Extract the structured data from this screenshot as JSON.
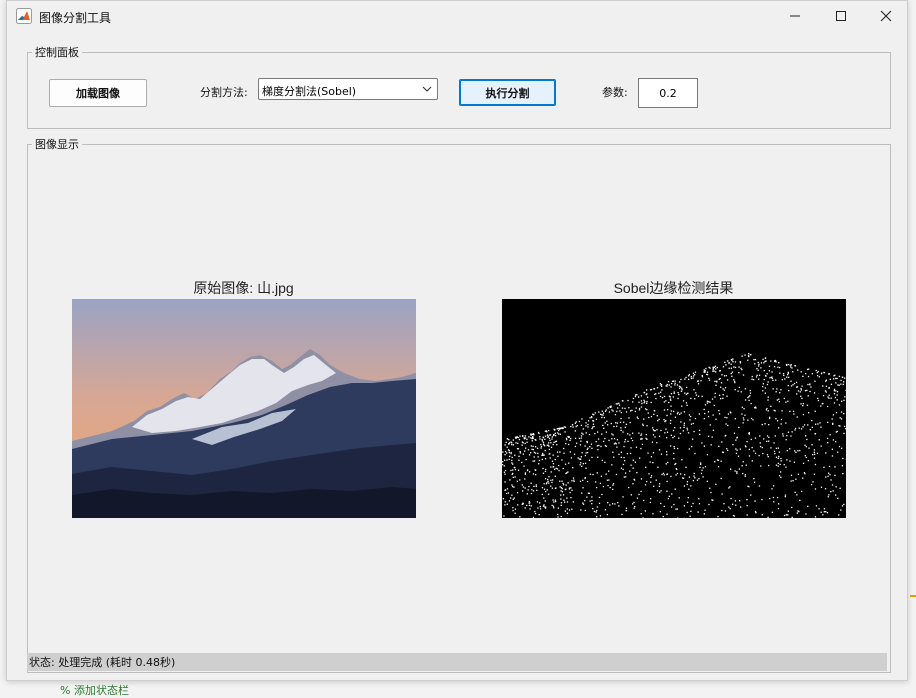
{
  "window": {
    "title": "图像分割工具"
  },
  "control_panel": {
    "legend": "控制面板",
    "load_button": "加载图像",
    "method_label": "分割方法:",
    "method_value": "梯度分割法(Sobel)",
    "run_button": "执行分割",
    "param_label": "参数:",
    "param_value": "0.2"
  },
  "display_panel": {
    "legend": "图像显示",
    "left_title": "原始图像: 山.jpg",
    "right_title": "Sobel边缘检测结果"
  },
  "status": {
    "text": "状态: 处理完成 (耗时 0.48秒)"
  },
  "behind_window_text": "% 添加状态栏",
  "colors": {
    "accent": "#0078d4",
    "window_bg": "#f0f0f0",
    "status_bg": "#cfcfcf",
    "edge_result_bg": "#000000"
  }
}
